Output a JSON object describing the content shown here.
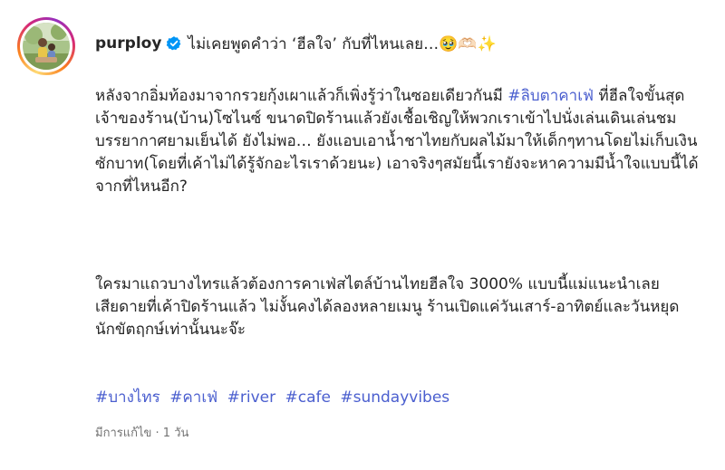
{
  "post": {
    "username": "purploy",
    "headline": "ไม่เคยพูดคำว่า ‘ฮีลใจ’ กับที่ไหนเลย…",
    "headline_emoji": "🥹🫶🏻✨"
  },
  "caption": {
    "p1_before": "หลังจากอิ่มท้องมาจากรวยกุ้งเผาแล้วก็เพิ่งรู้ว่าในซอยเดียวกันมี ",
    "p1_tag": "#ลิบตาคาเฟ่",
    "p1_after": " ที่ฮีลใจขั้นสุด เจ้าของร้าน(บ้าน)โซไนซ์ ขนาดปิดร้านแล้วยังเชื้อเชิญให้พวกเราเข้าไปนั่งเล่นเดินเล่นชมบรรยากาศยามเย็นได้ ยังไม่พอ… ยังแอบเอาน้ำชาไทยกับผลไม้มาให้เด็กๆทานโดยไม่เก็บเงินซักบาท(โดยที่เค้าไม่ได้รู้จักอะไรเราด้วยนะ) เอาจริงๆสมัยนี้เรายังจะหาความมีน้ำใจแบบนี้ได้จากที่ไหนอีก?",
    "p2": "ใครมาแถวบางไทรแล้วต้องการคาเฟ่สไตล์บ้านไทยฮีลใจ 3000% แบบนี้แม่แนะนำเลย เสียดายที่เค้าปิดร้านแล้ว ไม่งั้นคงได้ลองหลายเมนู ร้านเปิดแค่วันเสาร์-อาทิตย์และวันหยุด นักขัตฤกษ์เท่านั้นนะจ๊ะ"
  },
  "hashtags": [
    "#บางไทร",
    "#คาเฟ่",
    "#river",
    "#cafe",
    "#sundayvibes"
  ],
  "meta": {
    "edited": "มีการแก้ไข · 1 วัน"
  },
  "colors": {
    "link": "#4b5fcf",
    "verified": "#0095f6",
    "muted": "#737373",
    "text": "#262626"
  },
  "icons": {
    "verified": "verified-badge-icon"
  }
}
